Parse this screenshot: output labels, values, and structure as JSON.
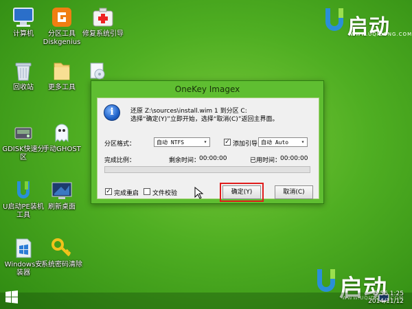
{
  "desktop": {
    "icons": [
      {
        "label": "计算机",
        "icon": "computer-icon"
      },
      {
        "label": "分区工具\nDiskgenius",
        "icon": "diskgenius-icon"
      },
      {
        "label": "修复系统引导",
        "icon": "first-aid-kit-icon"
      },
      {
        "label": "回收站",
        "icon": "recycle-bin-icon"
      },
      {
        "label": "更多工具",
        "icon": "folder-icon"
      },
      {
        "label": "GDISK快速分区",
        "icon": "gdisk-icon"
      },
      {
        "label": "手动GHOST",
        "icon": "ghost-icon"
      },
      {
        "label": "U启动PE装机工具",
        "icon": "u-install-icon"
      },
      {
        "label": "刷新桌面",
        "icon": "refresh-desktop-icon"
      },
      {
        "label": "Windows安装器",
        "icon": "windows-installer-icon"
      },
      {
        "label": "系统密码清除",
        "icon": "key-icon"
      }
    ],
    "brand": {
      "name": "启动",
      "site": "WWW.UQIDONG.COM"
    }
  },
  "dialog": {
    "title": "OneKey Imagex",
    "message_line1": "还原 Z:\\sources\\install.wim 1 到分区 C:",
    "message_line2": "选择“确定(Y)”立即开始，选择“取消(C)”返回主界面。",
    "partition_format_label": "分区格式：",
    "partition_format_value": "自动 NTFS",
    "add_boot_label": "添加引导",
    "add_boot_checked": true,
    "boot_mode_value": "自动 Auto",
    "progress_label": "完成比例：",
    "remaining_label": "剩余时间：",
    "remaining_value": "00:00:00",
    "elapsed_label": "已用时间：",
    "elapsed_value": "00:00:00",
    "progress_value": 0,
    "restart_label": "完成重启",
    "restart_checked": true,
    "verify_label": "文件校验",
    "verify_checked": false,
    "ok_button": "确定(Y)",
    "cancel_button": "取消(C)",
    "check_mark": "✓"
  },
  "taskbar": {
    "time": "5:56 1:25",
    "date": "2014/11/12"
  },
  "colors": {
    "accent_red": "#e01b1b",
    "desktop_green": "#4fae22",
    "title_green": "#5fbe31"
  }
}
